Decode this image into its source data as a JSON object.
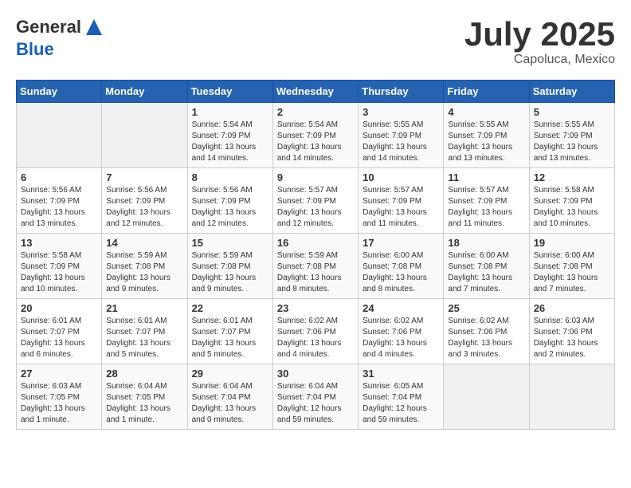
{
  "header": {
    "logo_line1": "General",
    "logo_line2": "Blue",
    "main_title": "July 2025",
    "subtitle": "Capoluca, Mexico"
  },
  "days_of_week": [
    "Sunday",
    "Monday",
    "Tuesday",
    "Wednesday",
    "Thursday",
    "Friday",
    "Saturday"
  ],
  "weeks": [
    [
      {
        "day": "",
        "info": ""
      },
      {
        "day": "",
        "info": ""
      },
      {
        "day": "1",
        "info": "Sunrise: 5:54 AM\nSunset: 7:09 PM\nDaylight: 13 hours\nand 14 minutes."
      },
      {
        "day": "2",
        "info": "Sunrise: 5:54 AM\nSunset: 7:09 PM\nDaylight: 13 hours\nand 14 minutes."
      },
      {
        "day": "3",
        "info": "Sunrise: 5:55 AM\nSunset: 7:09 PM\nDaylight: 13 hours\nand 14 minutes."
      },
      {
        "day": "4",
        "info": "Sunrise: 5:55 AM\nSunset: 7:09 PM\nDaylight: 13 hours\nand 13 minutes."
      },
      {
        "day": "5",
        "info": "Sunrise: 5:55 AM\nSunset: 7:09 PM\nDaylight: 13 hours\nand 13 minutes."
      }
    ],
    [
      {
        "day": "6",
        "info": "Sunrise: 5:56 AM\nSunset: 7:09 PM\nDaylight: 13 hours\nand 13 minutes."
      },
      {
        "day": "7",
        "info": "Sunrise: 5:56 AM\nSunset: 7:09 PM\nDaylight: 13 hours\nand 12 minutes."
      },
      {
        "day": "8",
        "info": "Sunrise: 5:56 AM\nSunset: 7:09 PM\nDaylight: 13 hours\nand 12 minutes."
      },
      {
        "day": "9",
        "info": "Sunrise: 5:57 AM\nSunset: 7:09 PM\nDaylight: 13 hours\nand 12 minutes."
      },
      {
        "day": "10",
        "info": "Sunrise: 5:57 AM\nSunset: 7:09 PM\nDaylight: 13 hours\nand 11 minutes."
      },
      {
        "day": "11",
        "info": "Sunrise: 5:57 AM\nSunset: 7:09 PM\nDaylight: 13 hours\nand 11 minutes."
      },
      {
        "day": "12",
        "info": "Sunrise: 5:58 AM\nSunset: 7:09 PM\nDaylight: 13 hours\nand 10 minutes."
      }
    ],
    [
      {
        "day": "13",
        "info": "Sunrise: 5:58 AM\nSunset: 7:09 PM\nDaylight: 13 hours\nand 10 minutes."
      },
      {
        "day": "14",
        "info": "Sunrise: 5:59 AM\nSunset: 7:08 PM\nDaylight: 13 hours\nand 9 minutes."
      },
      {
        "day": "15",
        "info": "Sunrise: 5:59 AM\nSunset: 7:08 PM\nDaylight: 13 hours\nand 9 minutes."
      },
      {
        "day": "16",
        "info": "Sunrise: 5:59 AM\nSunset: 7:08 PM\nDaylight: 13 hours\nand 8 minutes."
      },
      {
        "day": "17",
        "info": "Sunrise: 6:00 AM\nSunset: 7:08 PM\nDaylight: 13 hours\nand 8 minutes."
      },
      {
        "day": "18",
        "info": "Sunrise: 6:00 AM\nSunset: 7:08 PM\nDaylight: 13 hours\nand 7 minutes."
      },
      {
        "day": "19",
        "info": "Sunrise: 6:00 AM\nSunset: 7:08 PM\nDaylight: 13 hours\nand 7 minutes."
      }
    ],
    [
      {
        "day": "20",
        "info": "Sunrise: 6:01 AM\nSunset: 7:07 PM\nDaylight: 13 hours\nand 6 minutes."
      },
      {
        "day": "21",
        "info": "Sunrise: 6:01 AM\nSunset: 7:07 PM\nDaylight: 13 hours\nand 5 minutes."
      },
      {
        "day": "22",
        "info": "Sunrise: 6:01 AM\nSunset: 7:07 PM\nDaylight: 13 hours\nand 5 minutes."
      },
      {
        "day": "23",
        "info": "Sunrise: 6:02 AM\nSunset: 7:06 PM\nDaylight: 13 hours\nand 4 minutes."
      },
      {
        "day": "24",
        "info": "Sunrise: 6:02 AM\nSunset: 7:06 PM\nDaylight: 13 hours\nand 4 minutes."
      },
      {
        "day": "25",
        "info": "Sunrise: 6:02 AM\nSunset: 7:06 PM\nDaylight: 13 hours\nand 3 minutes."
      },
      {
        "day": "26",
        "info": "Sunrise: 6:03 AM\nSunset: 7:06 PM\nDaylight: 13 hours\nand 2 minutes."
      }
    ],
    [
      {
        "day": "27",
        "info": "Sunrise: 6:03 AM\nSunset: 7:05 PM\nDaylight: 13 hours\nand 1 minute."
      },
      {
        "day": "28",
        "info": "Sunrise: 6:04 AM\nSunset: 7:05 PM\nDaylight: 13 hours\nand 1 minute."
      },
      {
        "day": "29",
        "info": "Sunrise: 6:04 AM\nSunset: 7:04 PM\nDaylight: 13 hours\nand 0 minutes."
      },
      {
        "day": "30",
        "info": "Sunrise: 6:04 AM\nSunset: 7:04 PM\nDaylight: 12 hours\nand 59 minutes."
      },
      {
        "day": "31",
        "info": "Sunrise: 6:05 AM\nSunset: 7:04 PM\nDaylight: 12 hours\nand 59 minutes."
      },
      {
        "day": "",
        "info": ""
      },
      {
        "day": "",
        "info": ""
      }
    ]
  ]
}
